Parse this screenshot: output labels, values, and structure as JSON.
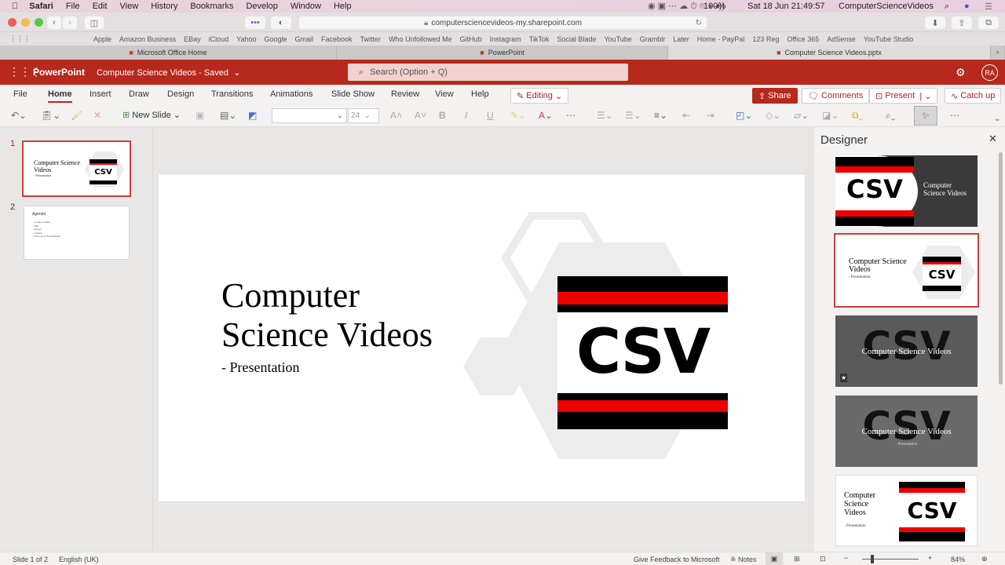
{
  "menubar": {
    "app": "Safari",
    "items": [
      "File",
      "Edit",
      "View",
      "History",
      "Bookmarks",
      "Develop",
      "Window",
      "Help"
    ],
    "battery": "100%",
    "datetime": "Sat 18 Jun  21:49:57",
    "user": "ComputerScienceVideos"
  },
  "browser": {
    "url": "computersciencevideos-my.sharepoint.com",
    "bookmarks": [
      "Apple",
      "Amazon Business",
      "EBay",
      "iCloud",
      "Yahoo",
      "Google",
      "Gmail",
      "Facebook",
      "Twitter",
      "Who Unfollowed Me",
      "GitHub",
      "Instagram",
      "TikTok",
      "Social Blade",
      "YouTube",
      "Gramblr",
      "Later",
      "Home - PayPal",
      "123 Reg",
      "Office 365",
      "AdSense",
      "YouTube Studio"
    ],
    "tabs": [
      "Microsoft Office Home",
      "PowerPoint",
      "Computer Science Videos.pptx"
    ]
  },
  "app": {
    "name": "PowerPoint",
    "doc_title": "Computer Science Videos",
    "status": "Saved",
    "search_placeholder": "Search (Option + Q)",
    "avatar": "RA",
    "accent": "#b7281d"
  },
  "ribbon": {
    "tabs": [
      "File",
      "Home",
      "Insert",
      "Draw",
      "Design",
      "Transitions",
      "Animations",
      "Slide Show",
      "Review",
      "View",
      "Help"
    ],
    "active": "Home",
    "editing": "Editing",
    "share": "Share",
    "comments": "Comments",
    "present": "Present",
    "catchup": "Catch up",
    "new_slide": "New Slide",
    "font_size": "24"
  },
  "slides": [
    {
      "num": "1",
      "title": "Computer Science Videos",
      "subtitle": "- Presentation"
    },
    {
      "num": "2",
      "title": "Agenda",
      "bullets": [
        "Create a Video",
        "Edit",
        "Export",
        "Upload",
        "Promote to Social Media"
      ]
    }
  ],
  "slide": {
    "title_line1": "Computer",
    "title_line2": "Science Videos",
    "subtitle": "- Presentation",
    "logo": "CSV"
  },
  "designer": {
    "title": "Designer",
    "thumb_title": "Computer Science Videos",
    "thumb_sub": "- Presentation"
  },
  "status": {
    "slide": "Slide 1 of 2",
    "language": "English (UK)",
    "feedback": "Give Feedback to Microsoft",
    "notes": "Notes",
    "zoom": "84%"
  }
}
